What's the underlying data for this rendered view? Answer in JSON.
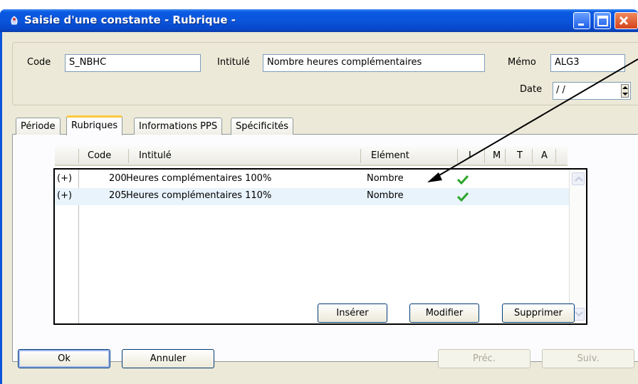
{
  "window": {
    "title": "Saisie d'une constante - Rubrique -",
    "buttons": {
      "minimize": "minimize-icon",
      "maximize": "maximize-icon",
      "close": "close-icon"
    }
  },
  "header": {
    "code_label": "Code",
    "code_value": "S_NBHC",
    "intitule_label": "Intitulé",
    "intitule_value": "Nombre heures complémentaires",
    "memo_label": "Mémo",
    "memo_value": "ALG3",
    "date_label": "Date",
    "date_value": "/ /"
  },
  "tabs": [
    {
      "label": "Période"
    },
    {
      "label": "Rubriques",
      "active": true
    },
    {
      "label": "Informations PPS"
    },
    {
      "label": "Spécificités"
    }
  ],
  "grid": {
    "columns": [
      "Code",
      "Intitulé",
      "Elément",
      "I",
      "M",
      "T",
      "A"
    ],
    "rows": [
      {
        "expand": "(+)",
        "code": "200",
        "intitule": "Heures complémentaires 100%",
        "element": "Nombre",
        "i": true,
        "selected": false
      },
      {
        "expand": "(+)",
        "code": "205",
        "intitule": "Heures complémentaires 110%",
        "element": "Nombre",
        "i": true,
        "selected": true
      }
    ]
  },
  "actions": {
    "inserer": "Insérer",
    "modifier": "Modifier",
    "supprimer": "Supprimer"
  },
  "footer": {
    "ok": "Ok",
    "annuler": "Annuler",
    "prec": "Préc.",
    "suiv": "Suiv."
  },
  "colors": {
    "titlebar": "#0a55dc",
    "dialog_bg": "#ece9d8",
    "selected_row": "#e8f3fb",
    "check": "#2aa52a",
    "tab_accent": "#ffc83c"
  }
}
